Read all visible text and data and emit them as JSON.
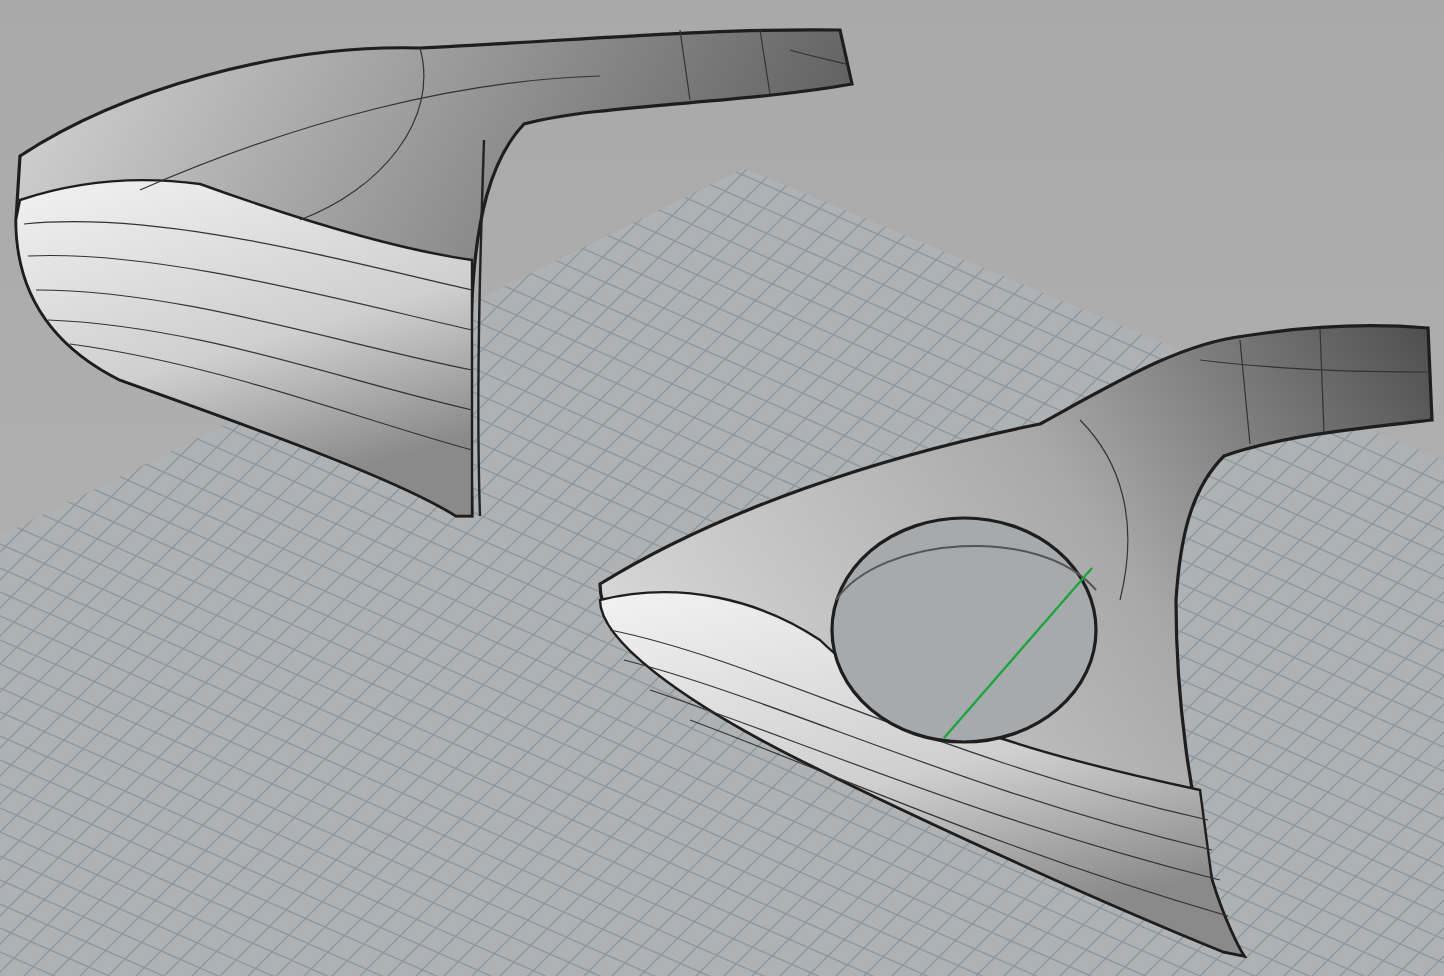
{
  "viewport": {
    "grid": true,
    "objects": [
      {
        "hole": false
      },
      {
        "hole": true
      }
    ]
  }
}
